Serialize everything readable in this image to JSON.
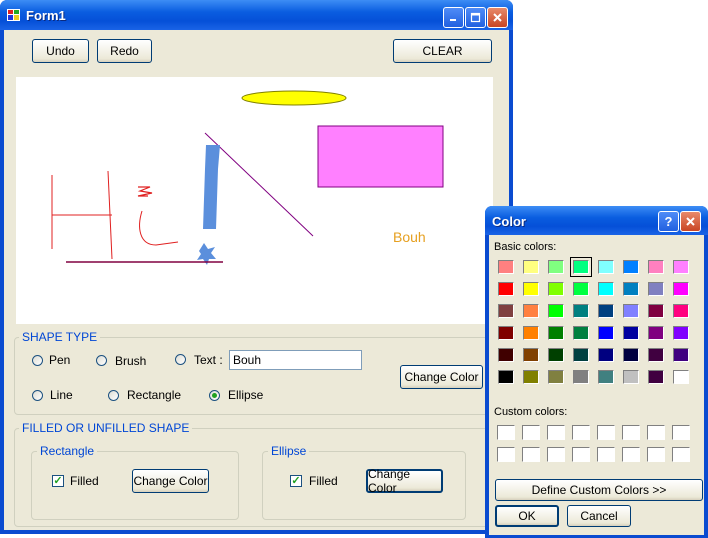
{
  "main_window": {
    "title": "Form1",
    "buttons": {
      "undo": "Undo",
      "redo": "Redo",
      "clear": "CLEAR"
    },
    "canvas": {
      "drawn_text": "Bouh"
    },
    "shape_type": {
      "group_label": "SHAPE TYPE",
      "pen": "Pen",
      "brush": "Brush",
      "text": "Text :",
      "text_value": "Bouh",
      "line": "Line",
      "rectangle": "Rectangle",
      "ellipse": "Ellipse",
      "selected": "ellipse",
      "change_color": "Change Color"
    },
    "filled_group": {
      "group_label": "FILLED OR UNFILLED SHAPE",
      "rectangle": {
        "label": "Rectangle",
        "filled_label": "Filled",
        "filled": true,
        "change_color": "Change Color"
      },
      "ellipse": {
        "label": "Ellipse",
        "filled_label": "Filled",
        "filled": true,
        "change_color": "Change Color"
      }
    }
  },
  "color_dialog": {
    "title": "Color",
    "help": "?",
    "basic_colors_label": "Basic colors:",
    "basic_colors": [
      [
        "#ff8080",
        "#ffff80",
        "#80ff80",
        "#00ff80",
        "#80ffff",
        "#0080ff",
        "#ff80c0",
        "#ff80ff"
      ],
      [
        "#ff0000",
        "#ffff00",
        "#80ff00",
        "#00ff40",
        "#00ffff",
        "#0080c0",
        "#8080c0",
        "#ff00ff"
      ],
      [
        "#804040",
        "#ff8040",
        "#00ff00",
        "#008080",
        "#004080",
        "#8080ff",
        "#800040",
        "#ff0080"
      ],
      [
        "#800000",
        "#ff8000",
        "#008000",
        "#008040",
        "#0000ff",
        "#0000a0",
        "#800080",
        "#8000ff"
      ],
      [
        "#400000",
        "#804000",
        "#004000",
        "#004040",
        "#000080",
        "#000040",
        "#400040",
        "#400080"
      ],
      [
        "#000000",
        "#808000",
        "#808040",
        "#808080",
        "#408080",
        "#c0c0c0",
        "#400040",
        "#ffffff"
      ]
    ],
    "selected_color": "#00ff80",
    "custom_colors_label": "Custom colors:",
    "define_custom": "Define Custom Colors >>",
    "ok": "OK",
    "cancel": "Cancel"
  },
  "colors": {
    "groupbox_text": "#0046d5",
    "title_bar": "#0a5de0",
    "window_bg": "#ece9d8",
    "canvas_text": "#e6a020"
  }
}
